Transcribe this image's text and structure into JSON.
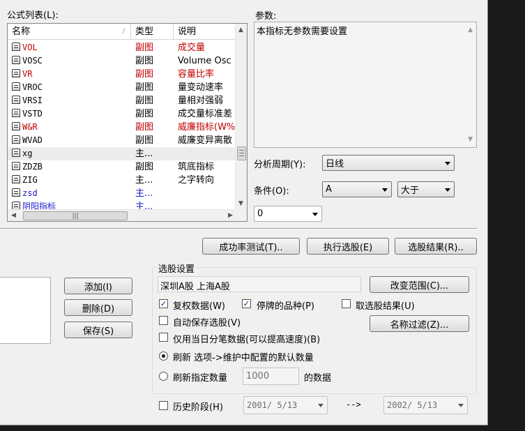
{
  "formula_list": {
    "label": "公式列表(L):",
    "columns": {
      "name": "名称",
      "type": "类型",
      "desc": "说明"
    },
    "rows": [
      {
        "name": "VOL",
        "type": "副图",
        "desc": "成交量",
        "color": "#c00000"
      },
      {
        "name": "VOSC",
        "type": "副图",
        "desc": "Volume Osc",
        "color": "#000000"
      },
      {
        "name": "VR",
        "type": "副图",
        "desc": "容量比率",
        "color": "#c00000"
      },
      {
        "name": "VROC",
        "type": "副图",
        "desc": "量变动速率",
        "color": "#000000"
      },
      {
        "name": "VRSI",
        "type": "副图",
        "desc": "量相对强弱",
        "color": "#000000"
      },
      {
        "name": "VSTD",
        "type": "副图",
        "desc": "成交量标准差",
        "color": "#000000"
      },
      {
        "name": "W&R",
        "type": "副图",
        "desc": "威廉指标(W%R)",
        "color": "#c00000"
      },
      {
        "name": "WVAD",
        "type": "副图",
        "desc": "威廉变异离散",
        "color": "#000000"
      },
      {
        "name": "xg",
        "type": "主...",
        "desc": "",
        "color": "#000000"
      },
      {
        "name": "ZDZB",
        "type": "副图",
        "desc": "筑底指标",
        "color": "#000000"
      },
      {
        "name": "ZIG",
        "type": "主...",
        "desc": "之字转向",
        "color": "#000000"
      },
      {
        "name": "zsd",
        "type": "主...",
        "desc": "",
        "color": "#1a1acc"
      },
      {
        "name": "阴阳指标",
        "type": "主...",
        "desc": "",
        "color": "#1a1acc"
      }
    ],
    "selected_index": 8
  },
  "params": {
    "label": "参数:",
    "text": "本指标无参数需要设置"
  },
  "period": {
    "label": "分析周期(Y):",
    "value": "日线"
  },
  "condition": {
    "label": "条件(O):",
    "line": "A",
    "op": "大于",
    "value": "0"
  },
  "buttons": {
    "success_test": "成功率测试(T)..",
    "execute": "执行选股(E)",
    "results": "选股结果(R)..",
    "add": "添加(I)",
    "delete": "删除(D)",
    "save": "保存(S)",
    "change_range": "改变范围(C)...",
    "name_filter": "名称过滤(Z)..."
  },
  "settings": {
    "title": "选股设置",
    "range_text": "深圳A股  上海A股",
    "adjusted": {
      "label": "复权数据(W)",
      "checked": true
    },
    "suspended": {
      "label": "停牌的品种(P)",
      "checked": true
    },
    "pick_results": {
      "label": "取选股结果(U)",
      "checked": false
    },
    "auto_save": {
      "label": "自动保存选股(V)",
      "checked": false
    },
    "intraday": {
      "label": "仅用当日分笔数据(可以提高速度)(B)",
      "checked": false
    },
    "refresh_default": {
      "label": "刷新 选项->维护中配置的默认数量",
      "selected": true
    },
    "refresh_count": {
      "label": "刷新指定数量",
      "value": "1000",
      "suffix": "的数据",
      "selected": false
    }
  },
  "history": {
    "label": "历史阶段(H)",
    "checked": false,
    "from": "2001/ 5/13",
    "arrow": "-->",
    "to": "2002/ 5/13"
  }
}
